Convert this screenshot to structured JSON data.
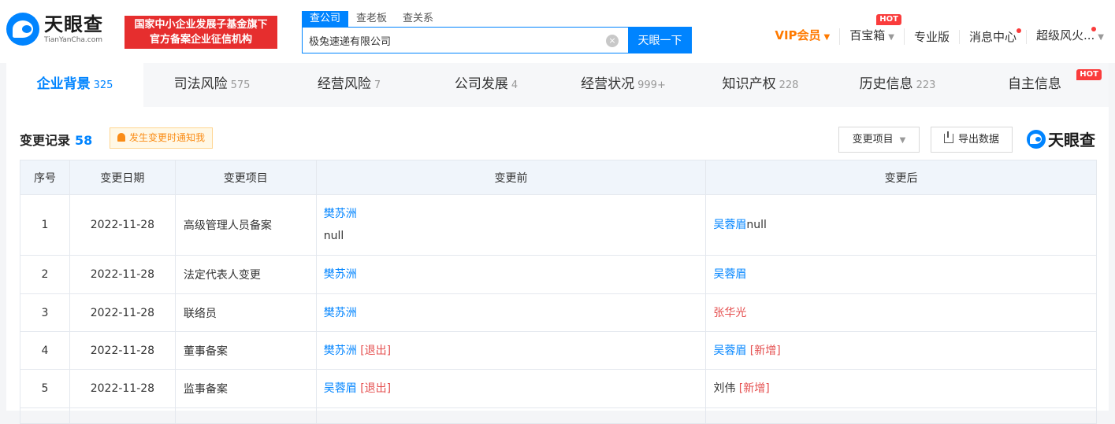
{
  "brand": {
    "name_cn": "天眼查",
    "name_en": "TianYanCha.com",
    "badge_line1": "国家中小企业发展子基金旗下",
    "badge_line2": "官方备案企业征信机构"
  },
  "search": {
    "tabs": [
      "查公司",
      "查老板",
      "查关系"
    ],
    "value": "极兔速递有限公司",
    "button_label": "天眼一下",
    "clear_symbol": "×"
  },
  "topnav": {
    "vip": "VIP会员",
    "baibao": "百宝箱",
    "hot": "HOT",
    "pro": "专业版",
    "messages": "消息中心",
    "user": "超级风火..."
  },
  "tabs": [
    {
      "label": "企业背景",
      "count": "325"
    },
    {
      "label": "司法风险",
      "count": "575"
    },
    {
      "label": "经营风险",
      "count": "7"
    },
    {
      "label": "公司发展",
      "count": "4"
    },
    {
      "label": "经营状况",
      "count": "999+"
    },
    {
      "label": "知识产权",
      "count": "228"
    },
    {
      "label": "历史信息",
      "count": "223"
    },
    {
      "label": "自主信息",
      "count": "",
      "hot": "HOT"
    }
  ],
  "section": {
    "title": "变更记录",
    "count": "58",
    "notify_label": "发生变更时通知我",
    "filter_label": "变更项目",
    "export_label": "导出数据",
    "brand_small": "天眼查"
  },
  "table": {
    "headers": [
      "序号",
      "变更日期",
      "变更项目",
      "变更前",
      "变更后"
    ],
    "rows": [
      {
        "no": "1",
        "date": "2022-11-28",
        "item": "高级管理人员备案",
        "before_name": "樊苏洲",
        "before_extra": "null",
        "after_name": "吴蓉眉",
        "after_extra": "null"
      },
      {
        "no": "2",
        "date": "2022-11-28",
        "item": "法定代表人变更",
        "before_name": "樊苏洲",
        "after_name": "吴蓉眉"
      },
      {
        "no": "3",
        "date": "2022-11-28",
        "item": "联络员",
        "before_name": "樊苏洲",
        "after_name": "张华光"
      },
      {
        "no": "4",
        "date": "2022-11-28",
        "item": "董事备案",
        "before_name": "樊苏洲",
        "before_tag": "[退出]",
        "after_name": "吴蓉眉",
        "after_tag": "[新增]"
      },
      {
        "no": "5",
        "date": "2022-11-28",
        "item": "监事备案",
        "before_name": "吴蓉眉",
        "before_tag": "[退出]",
        "after_name": "刘伟",
        "after_tag": "[新增]"
      }
    ]
  }
}
